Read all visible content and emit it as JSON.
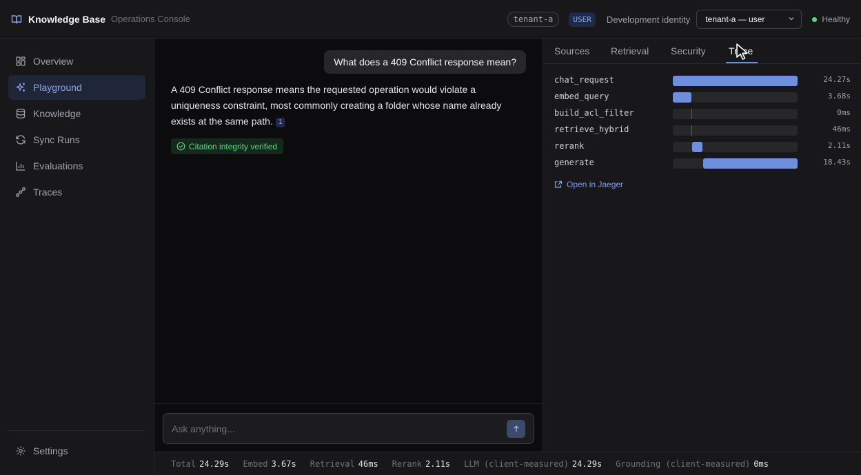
{
  "header": {
    "brand_title": "Knowledge Base",
    "brand_subtitle": "Operations Console",
    "tenant_chip": "tenant-a",
    "role_chip": "USER",
    "dev_identity_label": "Development identity",
    "identity_select_value": "tenant-a — user",
    "status_text": "Healthy",
    "status_color": "#4ade80"
  },
  "sidebar": {
    "items": [
      {
        "label": "Overview",
        "icon": "grid-icon",
        "active": false
      },
      {
        "label": "Playground",
        "icon": "sparkles-icon",
        "active": true
      },
      {
        "label": "Knowledge",
        "icon": "database-icon",
        "active": false
      },
      {
        "label": "Sync Runs",
        "icon": "refresh-icon",
        "active": false
      },
      {
        "label": "Evaluations",
        "icon": "bar-chart-icon",
        "active": false
      },
      {
        "label": "Traces",
        "icon": "workflow-icon",
        "active": false
      }
    ],
    "settings_label": "Settings"
  },
  "chat": {
    "user_message": "What does a 409 Conflict response mean?",
    "answer_text": "A 409 Conflict response means the requested operation would violate a uniqueness constraint, most commonly creating a folder whose name already exists at the same path.",
    "citation": "1",
    "verified_label": "Citation integrity verified",
    "input_placeholder": "Ask anything...",
    "input_value": ""
  },
  "panel": {
    "tabs": [
      {
        "label": "Sources",
        "active": false
      },
      {
        "label": "Retrieval",
        "active": false
      },
      {
        "label": "Security",
        "active": false
      },
      {
        "label": "Trace",
        "active": true
      }
    ],
    "trace_total_s": 24.27,
    "spans": [
      {
        "name": "chat_request",
        "duration": "24.27s",
        "start_s": 0,
        "dur_s": 24.27
      },
      {
        "name": "embed_query",
        "duration": "3.68s",
        "start_s": 0,
        "dur_s": 3.68
      },
      {
        "name": "build_acl_filter",
        "duration": "0ms",
        "start_s": 3.68,
        "dur_s": 0
      },
      {
        "name": "retrieve_hybrid",
        "duration": "46ms",
        "start_s": 3.68,
        "dur_s": 0.046
      },
      {
        "name": "rerank",
        "duration": "2.11s",
        "start_s": 3.73,
        "dur_s": 2.11
      },
      {
        "name": "generate",
        "duration": "18.43s",
        "start_s": 5.84,
        "dur_s": 18.43
      }
    ],
    "jaeger_link": "Open in Jaeger"
  },
  "footer": {
    "metrics": [
      {
        "key": "Total",
        "value": "24.29s"
      },
      {
        "key": "Embed",
        "value": "3.67s"
      },
      {
        "key": "Retrieval",
        "value": "46ms"
      },
      {
        "key": "Rerank",
        "value": "2.11s"
      },
      {
        "key": "LLM (client-measured)",
        "value": "24.29s"
      },
      {
        "key": "Grounding (client-measured)",
        "value": "0ms"
      }
    ]
  },
  "colors": {
    "accent": "#8aa4e8",
    "bar": "#6e8fdc",
    "background": "#0f0f11"
  }
}
